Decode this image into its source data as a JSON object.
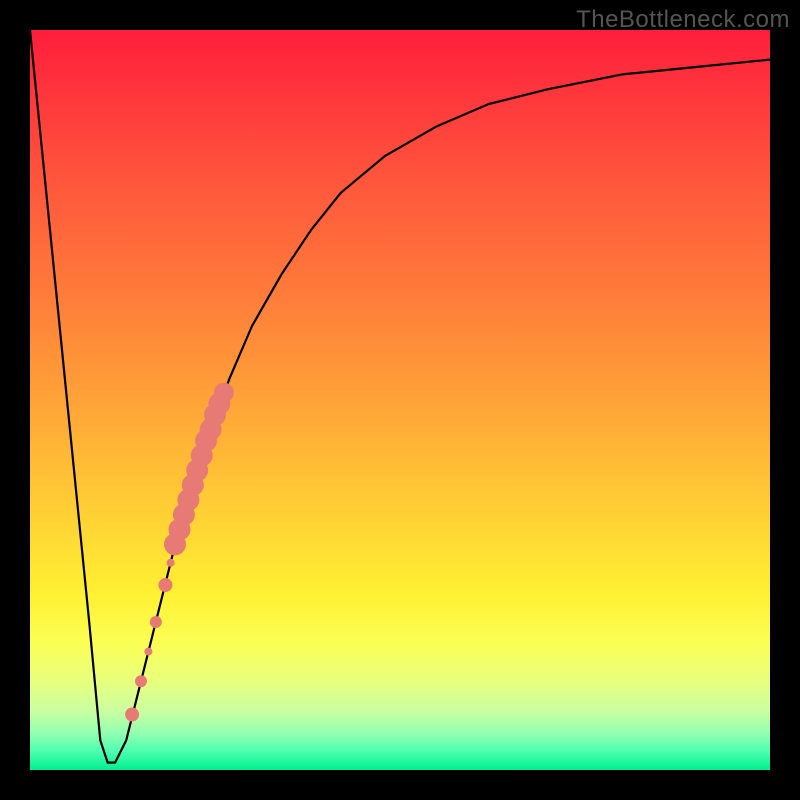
{
  "attribution": "TheBottleneck.com",
  "chart_data": {
    "type": "line",
    "title": "",
    "xlabel": "",
    "ylabel": "",
    "xlim": [
      0,
      100
    ],
    "ylim": [
      0,
      100
    ],
    "grid": false,
    "legend": false,
    "series": [
      {
        "name": "bottleneck-curve",
        "color": "#000000",
        "x": [
          0,
          2,
          4,
          6,
          8,
          9.5,
          10.5,
          11.5,
          13,
          15,
          18,
          20,
          22,
          24,
          27,
          30,
          34,
          38,
          42,
          48,
          55,
          62,
          70,
          80,
          90,
          100
        ],
        "y": [
          100,
          80,
          60,
          40,
          20,
          4,
          1,
          1,
          4,
          12,
          24,
          32,
          39,
          45,
          53,
          60,
          67,
          73,
          78,
          83,
          87,
          90,
          92,
          94,
          95,
          96
        ]
      },
      {
        "name": "highlight-band",
        "color": "#e77a75",
        "type": "scatter",
        "x": [
          13.8,
          15.0,
          16.0,
          17.0,
          18.3,
          19.0,
          19.6,
          20.2,
          20.8,
          21.4,
          22.0,
          22.6,
          23.2,
          23.8,
          24.4,
          25.0,
          25.6,
          26.2
        ],
        "y": [
          7.5,
          12.0,
          16.0,
          20.0,
          25.0,
          28.0,
          30.5,
          32.5,
          34.5,
          36.5,
          38.5,
          40.5,
          42.5,
          44.5,
          46.0,
          48.0,
          49.5,
          51.0
        ],
        "r": [
          7,
          6,
          4,
          6,
          7,
          4,
          11,
          11,
          11,
          11,
          11,
          11,
          11,
          11,
          11,
          11,
          11,
          10
        ]
      }
    ]
  }
}
